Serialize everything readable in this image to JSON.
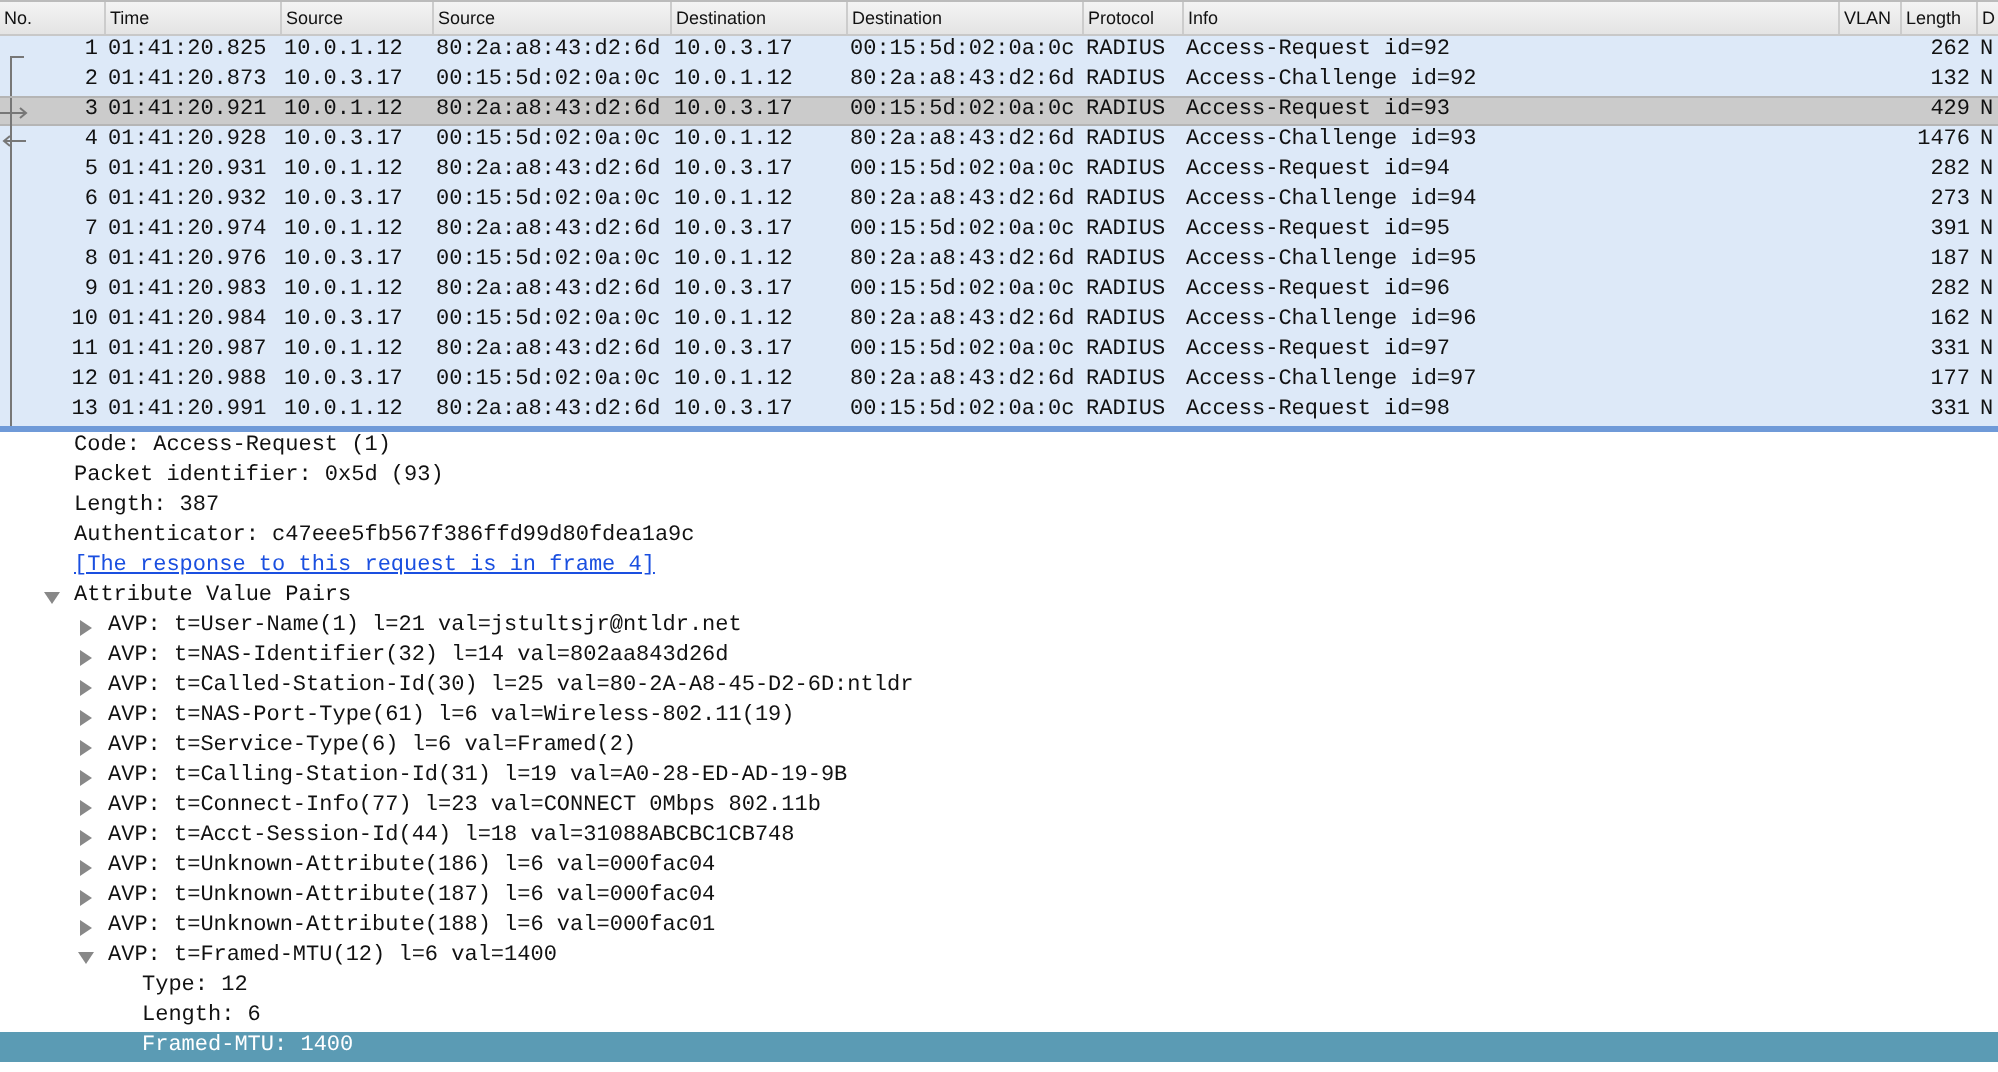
{
  "packet_list": {
    "columns": [
      "No.",
      "Time",
      "Source",
      "Source",
      "Destination",
      "Destination",
      "Protocol",
      "Info",
      "VLAN",
      "Length",
      "D"
    ],
    "rows": [
      {
        "cells": [
          "1",
          "01:41:20.825",
          "10.0.1.12",
          "80:2a:a8:43:d2:6d",
          "10.0.3.17",
          "00:15:5d:02:0a:0c",
          "RADIUS",
          "Access-Request id=92",
          "",
          "262",
          "N"
        ],
        "selected": false,
        "kind": "first"
      },
      {
        "cells": [
          "2",
          "01:41:20.873",
          "10.0.3.17",
          "00:15:5d:02:0a:0c",
          "10.0.1.12",
          "80:2a:a8:43:d2:6d",
          "RADIUS",
          "Access-Challenge id=92",
          "",
          "132",
          "N"
        ],
        "selected": false,
        "kind": "member"
      },
      {
        "cells": [
          "3",
          "01:41:20.921",
          "10.0.1.12",
          "80:2a:a8:43:d2:6d",
          "10.0.3.17",
          "00:15:5d:02:0a:0c",
          "RADIUS",
          "Access-Request id=93",
          "",
          "429",
          "N"
        ],
        "selected": true,
        "kind": "request"
      },
      {
        "cells": [
          "4",
          "01:41:20.928",
          "10.0.3.17",
          "00:15:5d:02:0a:0c",
          "10.0.1.12",
          "80:2a:a8:43:d2:6d",
          "RADIUS",
          "Access-Challenge id=93",
          "",
          "1476",
          "N"
        ],
        "selected": false,
        "kind": "response"
      },
      {
        "cells": [
          "5",
          "01:41:20.931",
          "10.0.1.12",
          "80:2a:a8:43:d2:6d",
          "10.0.3.17",
          "00:15:5d:02:0a:0c",
          "RADIUS",
          "Access-Request id=94",
          "",
          "282",
          "N"
        ],
        "selected": false,
        "kind": "member"
      },
      {
        "cells": [
          "6",
          "01:41:20.932",
          "10.0.3.17",
          "00:15:5d:02:0a:0c",
          "10.0.1.12",
          "80:2a:a8:43:d2:6d",
          "RADIUS",
          "Access-Challenge id=94",
          "",
          "273",
          "N"
        ],
        "selected": false,
        "kind": "member"
      },
      {
        "cells": [
          "7",
          "01:41:20.974",
          "10.0.1.12",
          "80:2a:a8:43:d2:6d",
          "10.0.3.17",
          "00:15:5d:02:0a:0c",
          "RADIUS",
          "Access-Request id=95",
          "",
          "391",
          "N"
        ],
        "selected": false,
        "kind": "member"
      },
      {
        "cells": [
          "8",
          "01:41:20.976",
          "10.0.3.17",
          "00:15:5d:02:0a:0c",
          "10.0.1.12",
          "80:2a:a8:43:d2:6d",
          "RADIUS",
          "Access-Challenge id=95",
          "",
          "187",
          "N"
        ],
        "selected": false,
        "kind": "member"
      },
      {
        "cells": [
          "9",
          "01:41:20.983",
          "10.0.1.12",
          "80:2a:a8:43:d2:6d",
          "10.0.3.17",
          "00:15:5d:02:0a:0c",
          "RADIUS",
          "Access-Request id=96",
          "",
          "282",
          "N"
        ],
        "selected": false,
        "kind": "member"
      },
      {
        "cells": [
          "10",
          "01:41:20.984",
          "10.0.3.17",
          "00:15:5d:02:0a:0c",
          "10.0.1.12",
          "80:2a:a8:43:d2:6d",
          "RADIUS",
          "Access-Challenge id=96",
          "",
          "162",
          "N"
        ],
        "selected": false,
        "kind": "member"
      },
      {
        "cells": [
          "11",
          "01:41:20.987",
          "10.0.1.12",
          "80:2a:a8:43:d2:6d",
          "10.0.3.17",
          "00:15:5d:02:0a:0c",
          "RADIUS",
          "Access-Request id=97",
          "",
          "331",
          "N"
        ],
        "selected": false,
        "kind": "member"
      },
      {
        "cells": [
          "12",
          "01:41:20.988",
          "10.0.3.17",
          "00:15:5d:02:0a:0c",
          "10.0.1.12",
          "80:2a:a8:43:d2:6d",
          "RADIUS",
          "Access-Challenge id=97",
          "",
          "177",
          "N"
        ],
        "selected": false,
        "kind": "member"
      },
      {
        "cells": [
          "13",
          "01:41:20.991",
          "10.0.1.12",
          "80:2a:a8:43:d2:6d",
          "10.0.3.17",
          "00:15:5d:02:0a:0c",
          "RADIUS",
          "Access-Request id=98",
          "",
          "331",
          "N"
        ],
        "selected": false,
        "kind": "member"
      }
    ]
  },
  "detail_tree": [
    {
      "text": "Code: Access-Request (1)",
      "selected": false
    },
    {
      "text": "Packet identifier: 0x5d (93)",
      "selected": false
    },
    {
      "text": "Length: 387",
      "selected": false
    },
    {
      "text": "Authenticator: c47eee5fb567f386ffd99d80fdea1a9c",
      "selected": false
    },
    {
      "text": "[The response to this request is in frame 4]",
      "kind": "link",
      "selected": false
    },
    {
      "text": "Attribute Value Pairs",
      "selected": false,
      "expanded": true,
      "children": [
        {
          "text": "AVP: t=User-Name(1) l=21 val=jstultsjr@ntldr.net",
          "selected": false,
          "expanded": false
        },
        {
          "text": "AVP: t=NAS-Identifier(32) l=14 val=802aa843d26d",
          "selected": false,
          "expanded": false
        },
        {
          "text": "AVP: t=Called-Station-Id(30) l=25 val=80-2A-A8-45-D2-6D:ntldr",
          "selected": false,
          "expanded": false
        },
        {
          "text": "AVP: t=NAS-Port-Type(61) l=6 val=Wireless-802.11(19)",
          "selected": false,
          "expanded": false
        },
        {
          "text": "AVP: t=Service-Type(6) l=6 val=Framed(2)",
          "selected": false,
          "expanded": false
        },
        {
          "text": "AVP: t=Calling-Station-Id(31) l=19 val=A0-28-ED-AD-19-9B",
          "selected": false,
          "expanded": false
        },
        {
          "text": "AVP: t=Connect-Info(77) l=23 val=CONNECT 0Mbps 802.11b",
          "selected": false,
          "expanded": false
        },
        {
          "text": "AVP: t=Acct-Session-Id(44) l=18 val=31088ABCBC1CB748",
          "selected": false,
          "expanded": false
        },
        {
          "text": "AVP: t=Unknown-Attribute(186) l=6 val=000fac04",
          "selected": false,
          "expanded": false
        },
        {
          "text": "AVP: t=Unknown-Attribute(187) l=6 val=000fac04",
          "selected": false,
          "expanded": false
        },
        {
          "text": "AVP: t=Unknown-Attribute(188) l=6 val=000fac01",
          "selected": false,
          "expanded": false
        },
        {
          "text": "AVP: t=Framed-MTU(12) l=6 val=1400",
          "selected": false,
          "expanded": true,
          "children": [
            {
              "text": "Type: 12",
              "selected": false
            },
            {
              "text": "Length: 6",
              "selected": false
            },
            {
              "text": "Framed-MTU: 1400",
              "selected": true
            }
          ]
        }
      ]
    }
  ]
}
